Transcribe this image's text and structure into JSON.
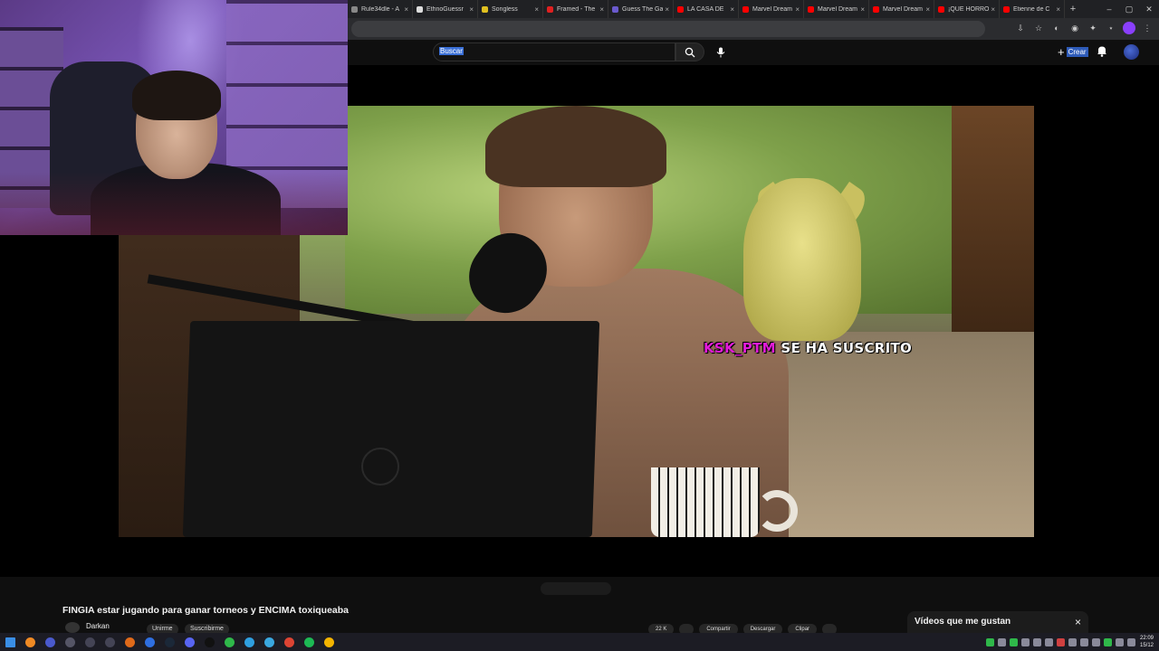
{
  "browser": {
    "tabs": [
      {
        "title": "Rule34dle - A",
        "color": "#888888"
      },
      {
        "title": "EthnoGuessr",
        "color": "#dddddd"
      },
      {
        "title": "Songless",
        "color": "#e0c020"
      },
      {
        "title": "Framed - The",
        "color": "#e02020"
      },
      {
        "title": "Guess The Ga",
        "color": "#6a5acd"
      },
      {
        "title": "LA CASA DE",
        "color": "#ff0000"
      },
      {
        "title": "Marvel Dream",
        "color": "#ff0000"
      },
      {
        "title": "Marvel Dream",
        "color": "#ff0000"
      },
      {
        "title": "Marvel Dream",
        "color": "#ff0000"
      },
      {
        "title": "¡QUE HORRO",
        "color": "#ff0000"
      },
      {
        "title": "Etienne de C",
        "color": "#ff0000"
      }
    ],
    "new_tab": "+",
    "close_glyph": "×",
    "window_controls": [
      "–",
      "▢",
      "✕"
    ]
  },
  "youtube": {
    "search": {
      "placeholder": "Buscar"
    },
    "create_label": "Crear",
    "create_plus": "+"
  },
  "stream_alert": {
    "user": "KSK_PTM",
    "message": "SE HA SUSCRITO"
  },
  "video": {
    "title": "FINGIA estar jugando para ganar torneos y ENCIMA toxiqueaba",
    "channel": "Darkan",
    "join_label": "Unirme",
    "subscribe_label": "Suscribirme",
    "actions": [
      "22 K",
      "",
      "Compartir",
      "Descargar",
      "Clipar",
      ""
    ]
  },
  "liked_panel": {
    "title": "Vídeos que me gustan",
    "close": "×"
  },
  "taskbar": {
    "apps": [
      {
        "icon": "windows-icon",
        "color": "#3a8ee6"
      },
      {
        "icon": "search-icon",
        "color": "#f08a24"
      },
      {
        "icon": "vpn-icon",
        "color": "#4a5acd"
      },
      {
        "icon": "app-icon",
        "color": "#555566"
      },
      {
        "icon": "arrow-app-icon",
        "color": "#444455"
      },
      {
        "icon": "window-app-icon",
        "color": "#444455"
      },
      {
        "icon": "orange-app-icon",
        "color": "#e06a1a"
      },
      {
        "icon": "streamlabs-icon",
        "color": "#2f6fe0"
      },
      {
        "icon": "steam-icon",
        "color": "#1b2838"
      },
      {
        "icon": "discord-icon",
        "color": "#5865f2"
      },
      {
        "icon": "tiktok-icon",
        "color": "#111111"
      },
      {
        "icon": "green-app-icon",
        "color": "#2fb84a"
      },
      {
        "icon": "check-app-icon",
        "color": "#2f9fe0"
      },
      {
        "icon": "refresh-app-icon",
        "color": "#3aa8e0"
      },
      {
        "icon": "chrome-app-icon",
        "color": "#dd4433"
      },
      {
        "icon": "spotify-icon",
        "color": "#1db954"
      },
      {
        "icon": "chrome-icon",
        "color": "#f4b400"
      }
    ],
    "time": "22:09",
    "date": "15/12"
  }
}
